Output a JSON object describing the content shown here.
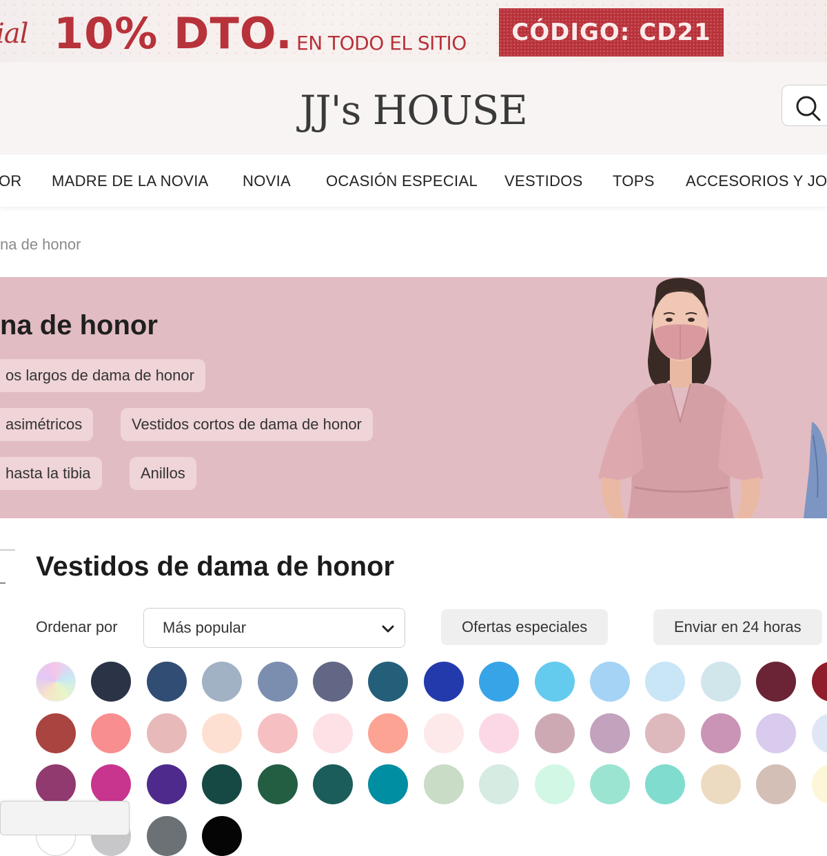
{
  "promo": {
    "script_text": "ial",
    "discount": "10% DTO.",
    "scope": "EN TODO EL SITIO",
    "code": "CÓDIGO: CD21"
  },
  "header": {
    "logo": "JJ's HOUSE",
    "search_icon": "search-icon"
  },
  "nav": {
    "items": [
      "OR",
      "MADRE DE LA NOVIA",
      "NOVIA",
      "OCASIÓN ESPECIAL",
      "VESTIDOS",
      "TOPS",
      "ACCESORIOS Y JOY"
    ]
  },
  "breadcrumb": "na de honor",
  "hero": {
    "title": "na de honor",
    "chips": [
      "os largos de dama de honor",
      "asimétricos",
      "Vestidos cortos de dama de honor",
      "hasta la tibia",
      "Anillos"
    ]
  },
  "listing": {
    "title": "Vestidos de dama de honor",
    "sort_label": "Ordenar por",
    "sort_value": "Más popular",
    "filters": [
      "Ofertas especiales",
      "Enviar en 24 horas"
    ]
  },
  "colors": {
    "row1": [
      "multicolor",
      "#2b3447",
      "#314d74",
      "#a1b2c5",
      "#7c8eb0",
      "#626785",
      "#245f7a",
      "#233aad",
      "#37a4e8",
      "#65cbee",
      "#a5d3f5",
      "#c9e6f7",
      "#d1e6eb",
      "#6a2436",
      "#8f1d2c"
    ],
    "row2": [
      "#a94441",
      "#f98e91",
      "#e8b9b9",
      "#fde0d2",
      "#f6bfc1",
      "#fde1e6",
      "#fca394",
      "#fde8ea",
      "#fcd8e6",
      "#cdaab3",
      "#c3a2bd",
      "#ddb8bd",
      "#ca94b7",
      "#d8cbee",
      "#dfe7f6"
    ],
    "row3": [
      "#913a70",
      "#c8358f",
      "#4d2a8b",
      "#164944",
      "#235e42",
      "#1b5d5b",
      "#008ea2",
      "#c9dcc6",
      "#d6ebe1",
      "#d2f8e5",
      "#9be4d2",
      "#7fdcce",
      "#eddbc1",
      "#d3bfb5",
      "#fdf6d8"
    ],
    "row4": [
      "#ffffff",
      "#c7c7c9",
      "#6b7174",
      "#050505"
    ]
  }
}
